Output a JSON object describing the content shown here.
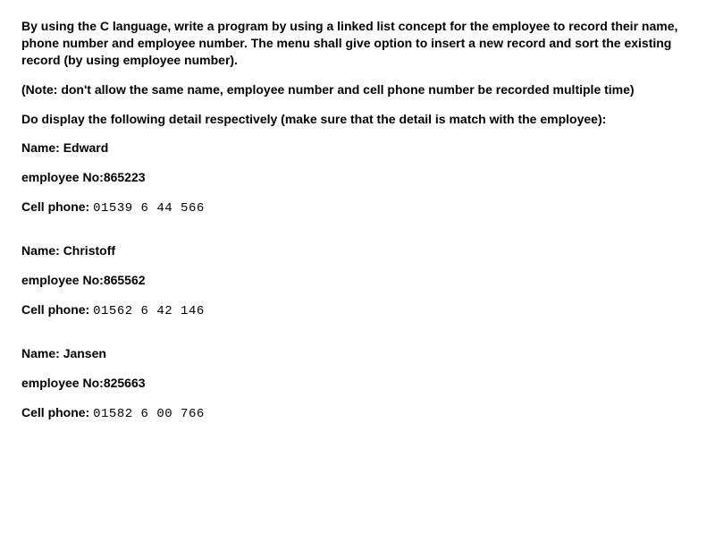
{
  "intro": {
    "p1": "By using the C language, write a program by using a linked list concept for the employee to record their name, phone number and employee number. The menu shall give option to insert a new record and sort the existing record (by using employee number).",
    "p2": "(Note: don't allow the same name, employee number and cell phone number be recorded multiple time)",
    "p3": "Do display the following detail respectively (make sure that the detail is match with the employee):"
  },
  "labels": {
    "name": "Name: ",
    "emp_no": "employee No:",
    "cell": "Cell phone: "
  },
  "employees": [
    {
      "name": "Edward",
      "emp_no": "865223",
      "cell": "01539 6 44 566"
    },
    {
      "name": "Christoff",
      "emp_no": "865562",
      "cell": "01562 6 42 146"
    },
    {
      "name": "Jansen",
      "emp_no": "825663",
      "cell": "01582 6 00 766"
    }
  ]
}
